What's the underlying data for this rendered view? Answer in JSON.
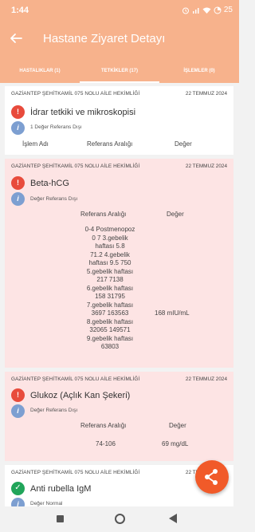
{
  "status": {
    "time": "1:44",
    "battery": "25"
  },
  "app": {
    "title": "Hastane Ziyaret Detayı",
    "back_icon": "arrow-left-icon"
  },
  "tabs": [
    {
      "label": "HASTALIKLAR (1)",
      "active": false
    },
    {
      "label": "TETKİKLER (17)",
      "active": true
    },
    {
      "label": "İŞLEMLER (0)",
      "active": false
    }
  ],
  "cards": [
    {
      "facility": "GAZİANTEP ŞEHİTKAMİL 075 NOLU AİLE HEKİMLİĞİ",
      "date": "22 TEMMUZ 2024",
      "test": "İdrar tetkiki ve mikroskopisi",
      "note": "1 Değer Referans Dışı",
      "col_process": "İşlem Adı",
      "col_ref": "Referans Aralığı",
      "col_value": "Değer"
    },
    {
      "facility": "GAZİANTEP ŞEHİTKAMİL 075 NOLU AİLE HEKİMLİĞİ",
      "date": "22 TEMMUZ 2024",
      "test": "Beta-hCG",
      "note": "Değer Referans Dışı",
      "col_ref": "Referans Aralığı",
      "col_value": "Değer",
      "ref_lines": [
        "0-4 Postmenopoz",
        "0 7 3.gebelik",
        "haftası 5.8",
        "71.2 4.gebelik",
        "haftası 9.5 750",
        "5.gebelik haftası",
        "217 7138",
        "6.gebelik haftası",
        "158 31795",
        "7.gebelik haftası",
        "3697 163563",
        "8.gebelik haftası",
        "32065 149571",
        "9.gebelik haftası",
        "63803"
      ],
      "value": "168 mIU/mL"
    },
    {
      "facility": "GAZİANTEP ŞEHİTKAMİL 075 NOLU AİLE HEKİMLİĞİ",
      "date": "22 TEMMUZ 2024",
      "test": "Glukoz (Açlık Kan Şekeri)",
      "note": "Değer Referans Dışı",
      "col_ref": "Referans Aralığı",
      "col_value": "Değer",
      "ref": "74-106",
      "value": "69 mg/dL"
    },
    {
      "facility": "GAZİANTEP ŞEHİTKAMİL 075 NOLU AİLE HEKİMLİĞİ",
      "date": "22 TEMMUZ 2024",
      "test": "Anti rubella IgM",
      "note": "Değer Normal"
    }
  ],
  "colors": {
    "accent": "#f7b28c",
    "warning": "#e84b3c",
    "ok": "#21a55a",
    "info": "#7d9fd1",
    "fab": "#f15a29",
    "alert_card": "#fde4e4"
  }
}
